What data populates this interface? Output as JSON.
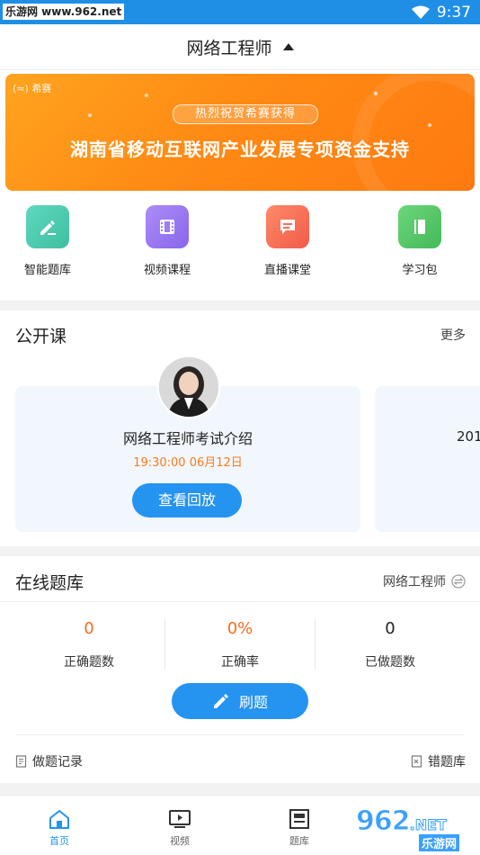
{
  "status_bar": {
    "watermark": "乐游网 www.962.net",
    "time": "9:37"
  },
  "header": {
    "title": "网络工程师"
  },
  "banner": {
    "brand": "希赛",
    "tagline": "热烈祝贺希赛获得",
    "headline": "湖南省移动互联网产业发展专项资金支持"
  },
  "categories": [
    {
      "label": "智能题库",
      "color": "#4ecdb1",
      "icon": "pencil-icon"
    },
    {
      "label": "视频课程",
      "color": "#9d7cf3",
      "icon": "video-icon"
    },
    {
      "label": "直播课堂",
      "color": "#fb6f5a",
      "icon": "chat-icon"
    },
    {
      "label": "学习包",
      "color": "#57c86a",
      "icon": "book-icon"
    }
  ],
  "open_course": {
    "title": "公开课",
    "more": "更多",
    "cards": [
      {
        "title": "网络工程师考试介绍",
        "time": "19:30:00  06月12日",
        "button": "查看回放"
      },
      {
        "year": "201"
      }
    ]
  },
  "question_bank": {
    "title": "在线题库",
    "course": "网络工程师",
    "stats": [
      {
        "value": "0",
        "label": "正确题数",
        "color": "#ff6a1a"
      },
      {
        "value": "0%",
        "label": "正确率",
        "color": "#ff6a1a"
      },
      {
        "value": "0",
        "label": "已做题数",
        "color": "#222222"
      }
    ],
    "practice_button": "刷题",
    "records": "做题记录",
    "wrong": "错题库"
  },
  "tabbar": [
    {
      "label": "首页",
      "icon": "home-icon",
      "active": true
    },
    {
      "label": "视频",
      "icon": "tv-icon",
      "active": false
    },
    {
      "label": "题库",
      "icon": "book-stack-icon",
      "active": false
    }
  ],
  "watermark": {
    "brand_number": "962",
    "net": ".NET",
    "site": "乐游网"
  }
}
